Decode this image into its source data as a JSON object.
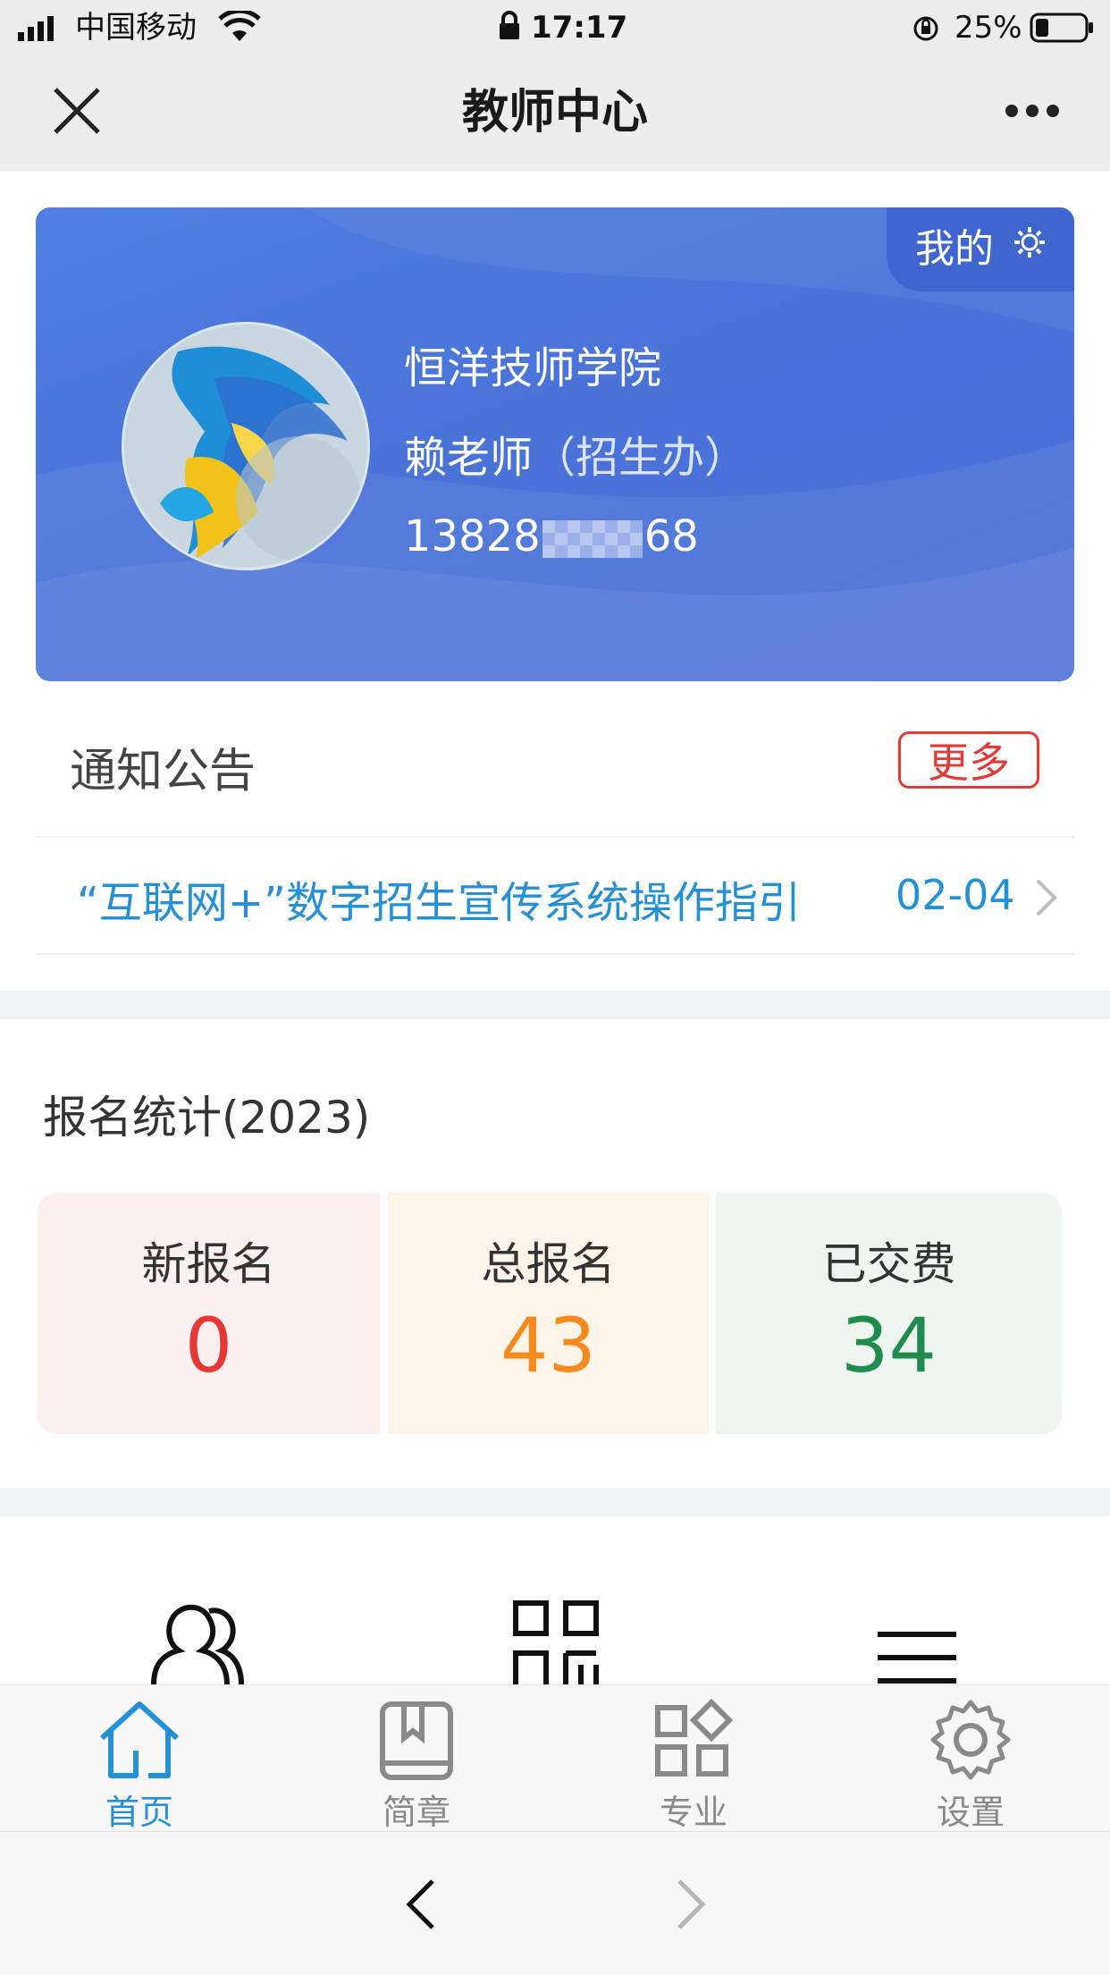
{
  "status_bar": {
    "carrier": "中国移动",
    "time": "17:17",
    "battery": "25%"
  },
  "nav": {
    "title": "教师中心"
  },
  "profile": {
    "mine_label": "我的",
    "school": "恒洋技师学院",
    "teacher": "赖老师",
    "department": "（招生办）",
    "phone_prefix": "13828",
    "phone_suffix": "68"
  },
  "notice": {
    "title": "通知公告",
    "more": "更多",
    "items": [
      {
        "text": "“互联网+”数字招生宣传系统操作指引",
        "date": "02-04"
      }
    ]
  },
  "stats": {
    "title": "报名统计(2023)",
    "boxes": [
      {
        "label": "新报名",
        "value": "0",
        "color": "#e53935",
        "bg": "#fcf0f1"
      },
      {
        "label": "总报名",
        "value": "43",
        "color": "#f5891d",
        "bg": "#fef5ea"
      },
      {
        "label": "已交费",
        "value": "34",
        "color": "#1f8b4c",
        "bg": "#eff5f1"
      }
    ]
  },
  "tabbar": {
    "tabs": [
      {
        "label": "首页",
        "active": true
      },
      {
        "label": "简章",
        "active": false
      },
      {
        "label": "专业",
        "active": false
      },
      {
        "label": "设置",
        "active": false
      }
    ],
    "active_color": "#2390d8",
    "inactive_color": "#8a8a8a"
  }
}
